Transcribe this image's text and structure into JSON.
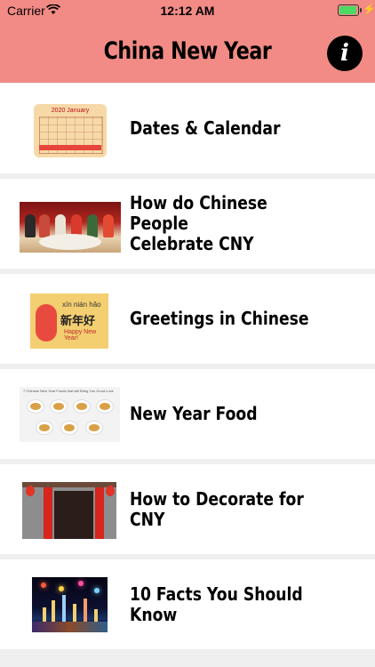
{
  "status_bar": {
    "carrier": "Carrier",
    "time": "12:12 AM"
  },
  "nav": {
    "title": "China New Year",
    "info_icon": "info-icon",
    "info_glyph": "i"
  },
  "items": [
    {
      "label": "Dates & Calendar",
      "icon": "calendar-thumbnail"
    },
    {
      "label": "How do Chinese People\nCelebrate CNY",
      "icon": "family-dinner-thumbnail"
    },
    {
      "label": "Greetings in Chinese",
      "icon": "greeting-card-thumbnail"
    },
    {
      "label": "New Year Food",
      "icon": "food-thumbnail"
    },
    {
      "label": "How to Decorate for CNY",
      "icon": "decoration-thumbnail"
    },
    {
      "label": "10 Facts You Should Know",
      "icon": "fireworks-thumbnail"
    }
  ],
  "thumbnail_text": {
    "calendar_header": "2020 January",
    "greeting_pinyin": "xīn nián hǎo",
    "greeting_chinese": "新年好",
    "greeting_english": "Happy New Year!",
    "food_caption": "7 Chinese New Year Foods that will Bring You Good Luck"
  },
  "colors": {
    "header": "#f28b85",
    "background": "#efefef",
    "row": "#ffffff"
  }
}
